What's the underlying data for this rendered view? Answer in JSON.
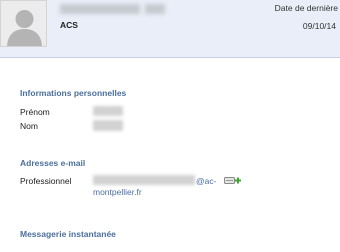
{
  "header": {
    "organization": "ACS",
    "date_label": "Date de dernière",
    "date_value": "09/10/14",
    "avatar_icon": "user-silhouette-icon"
  },
  "personal": {
    "title": "Informations personnelles",
    "firstname_label": "Prénom",
    "lastname_label": "Nom"
  },
  "emails": {
    "title": "Adresses e-mail",
    "professional_label": "Professionnel",
    "email_suffix_line1": "@ac-",
    "email_suffix_line2": "montpellier.fr",
    "edit_icon": "edit-add-icon"
  },
  "messaging": {
    "title": "Messagerie instantanée"
  },
  "colors": {
    "header_bg": "#e9eef8",
    "section_title": "#4b6f9c",
    "link": "#4a6fa5"
  }
}
